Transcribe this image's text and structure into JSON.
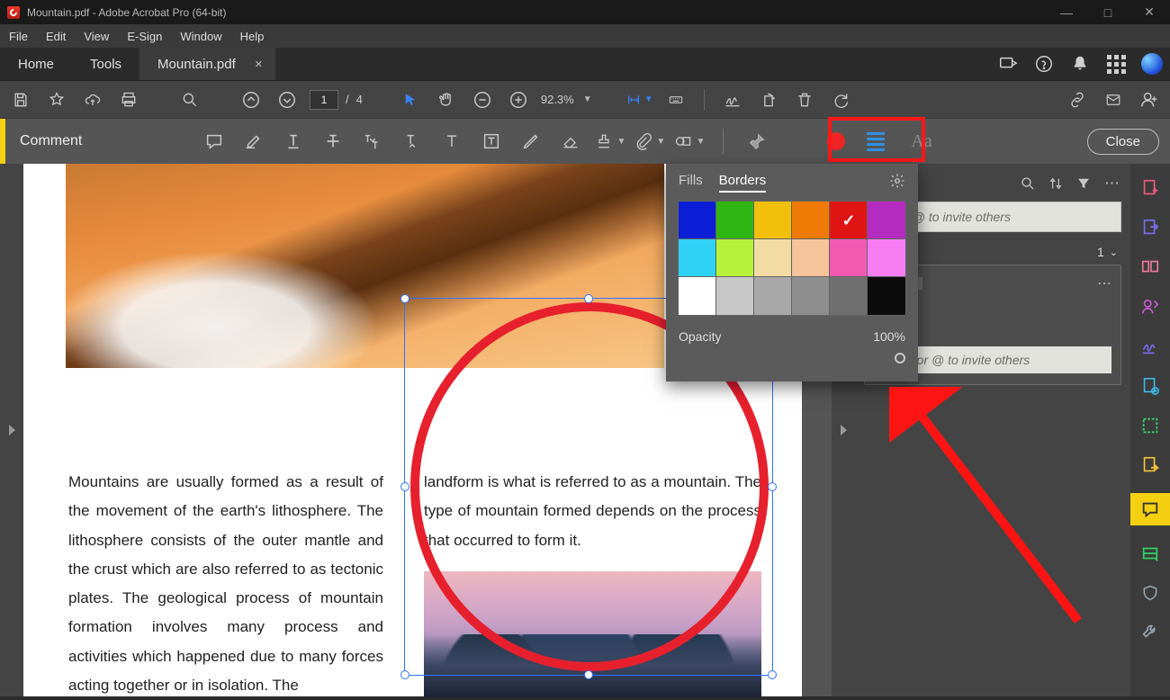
{
  "titlebar": {
    "title": "Mountain.pdf - Adobe Acrobat Pro (64-bit)"
  },
  "menu": {
    "items": [
      "File",
      "Edit",
      "View",
      "E-Sign",
      "Window",
      "Help"
    ]
  },
  "tabs": {
    "home": "Home",
    "tools": "Tools",
    "doc": "Mountain.pdf"
  },
  "toolbar": {
    "page_current": "1",
    "page_total": "4",
    "page_sep": "/",
    "zoom": "92.3%"
  },
  "commentbar": {
    "label": "Comment",
    "close": "Close",
    "aa": "Aa"
  },
  "colorpanel": {
    "tab_fills": "Fills",
    "tab_borders": "Borders",
    "opacity_label": "Opacity",
    "opacity_value": "100%",
    "swatches": [
      {
        "c": "#0a1fd6"
      },
      {
        "c": "#2fb612"
      },
      {
        "c": "#f2bf0b"
      },
      {
        "c": "#ef7b06"
      },
      {
        "c": "#e11414",
        "sel": true
      },
      {
        "c": "#b32bbf"
      },
      {
        "c": "#2fd1f4"
      },
      {
        "c": "#b6f23b"
      },
      {
        "c": "#f2dca4"
      },
      {
        "c": "#f6c39b"
      },
      {
        "c": "#f25ab0"
      },
      {
        "c": "#f77ef2"
      },
      {
        "c": "#ffffff"
      },
      {
        "c": "#c7c7c7"
      },
      {
        "c": "#a8a8a8"
      },
      {
        "c": "#8e8e8e"
      },
      {
        "c": "#6f6f6f"
      },
      {
        "c": "#0b0b0b"
      }
    ]
  },
  "doc": {
    "left": "Mountains are usually formed as a result of the movement of the earth's lithosphere. The lithosphere consists of the outer mantle and the crust which are also referred to as tectonic plates. The geological process of mountain formation involves many process and activities which happened due to many forces acting together or in isolation. The",
    "right": "landform is what is referred to as a mountain. The type of mountain formed depends on the process that occurred to form it."
  },
  "rpanel": {
    "search_placeholder": "or use @ to invite others",
    "count": "1",
    "reply_placeholder": "Reply or        @ to invite others"
  }
}
